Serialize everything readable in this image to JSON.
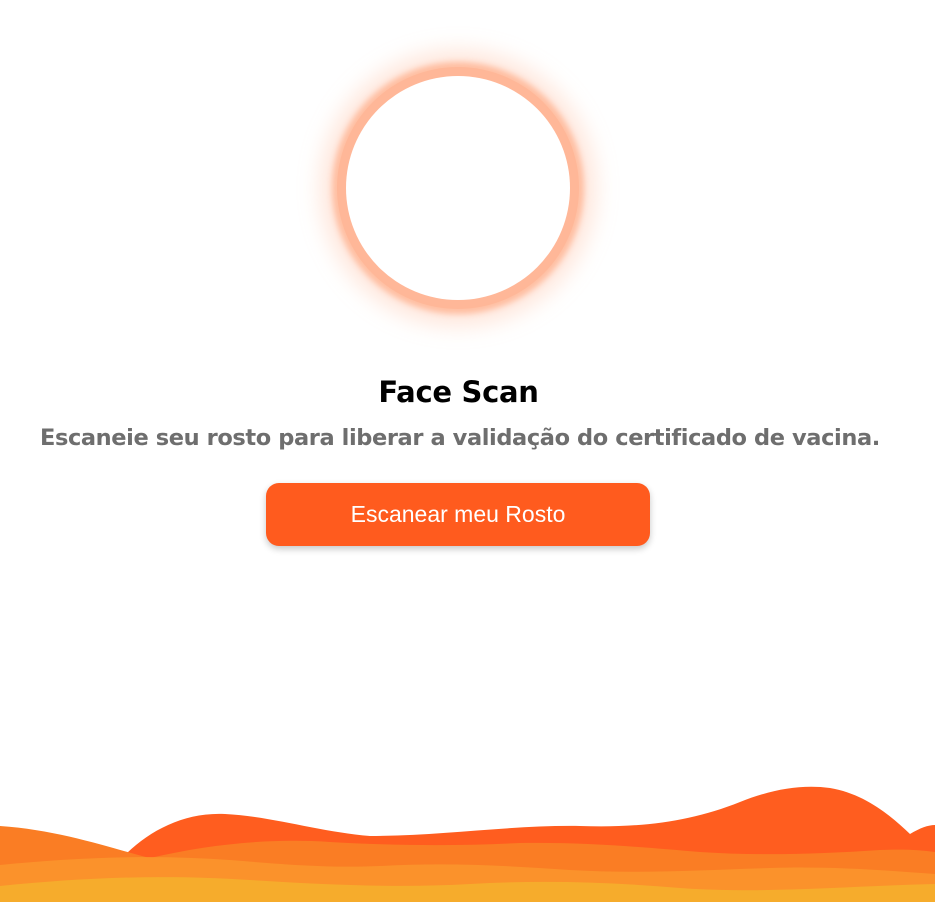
{
  "scan": {
    "title": "Face Scan",
    "subtitle": "Escaneie seu rosto para liberar a validação do certificado de vacina.",
    "button_label": "Escanear meu Rosto"
  },
  "colors": {
    "accent": "#ff5b1e",
    "ring": "#ffb798",
    "subtitle_text": "#6e6e6e",
    "wave_orange": "#ff6a22",
    "wave_amber": "#fb8f2a",
    "wave_yellow": "#f7ab2b"
  }
}
